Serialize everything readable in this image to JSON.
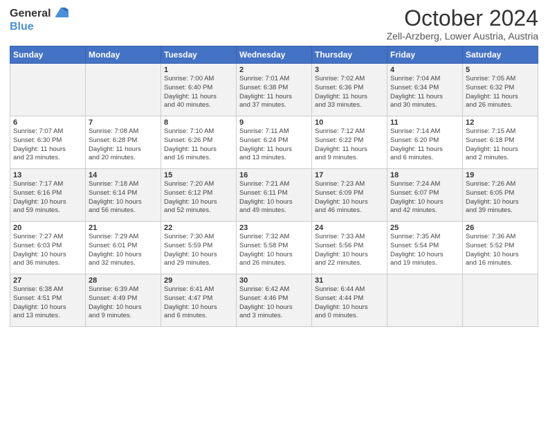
{
  "header": {
    "logo_line1": "General",
    "logo_line2": "Blue",
    "title": "October 2024",
    "location": "Zell-Arzberg, Lower Austria, Austria"
  },
  "days_of_week": [
    "Sunday",
    "Monday",
    "Tuesday",
    "Wednesday",
    "Thursday",
    "Friday",
    "Saturday"
  ],
  "weeks": [
    [
      {
        "day": "",
        "info": ""
      },
      {
        "day": "",
        "info": ""
      },
      {
        "day": "1",
        "info": "Sunrise: 7:00 AM\nSunset: 6:40 PM\nDaylight: 11 hours\nand 40 minutes."
      },
      {
        "day": "2",
        "info": "Sunrise: 7:01 AM\nSunset: 6:38 PM\nDaylight: 11 hours\nand 37 minutes."
      },
      {
        "day": "3",
        "info": "Sunrise: 7:02 AM\nSunset: 6:36 PM\nDaylight: 11 hours\nand 33 minutes."
      },
      {
        "day": "4",
        "info": "Sunrise: 7:04 AM\nSunset: 6:34 PM\nDaylight: 11 hours\nand 30 minutes."
      },
      {
        "day": "5",
        "info": "Sunrise: 7:05 AM\nSunset: 6:32 PM\nDaylight: 11 hours\nand 26 minutes."
      }
    ],
    [
      {
        "day": "6",
        "info": "Sunrise: 7:07 AM\nSunset: 6:30 PM\nDaylight: 11 hours\nand 23 minutes."
      },
      {
        "day": "7",
        "info": "Sunrise: 7:08 AM\nSunset: 6:28 PM\nDaylight: 11 hours\nand 20 minutes."
      },
      {
        "day": "8",
        "info": "Sunrise: 7:10 AM\nSunset: 6:26 PM\nDaylight: 11 hours\nand 16 minutes."
      },
      {
        "day": "9",
        "info": "Sunrise: 7:11 AM\nSunset: 6:24 PM\nDaylight: 11 hours\nand 13 minutes."
      },
      {
        "day": "10",
        "info": "Sunrise: 7:12 AM\nSunset: 6:22 PM\nDaylight: 11 hours\nand 9 minutes."
      },
      {
        "day": "11",
        "info": "Sunrise: 7:14 AM\nSunset: 6:20 PM\nDaylight: 11 hours\nand 6 minutes."
      },
      {
        "day": "12",
        "info": "Sunrise: 7:15 AM\nSunset: 6:18 PM\nDaylight: 11 hours\nand 2 minutes."
      }
    ],
    [
      {
        "day": "13",
        "info": "Sunrise: 7:17 AM\nSunset: 6:16 PM\nDaylight: 10 hours\nand 59 minutes."
      },
      {
        "day": "14",
        "info": "Sunrise: 7:18 AM\nSunset: 6:14 PM\nDaylight: 10 hours\nand 56 minutes."
      },
      {
        "day": "15",
        "info": "Sunrise: 7:20 AM\nSunset: 6:12 PM\nDaylight: 10 hours\nand 52 minutes."
      },
      {
        "day": "16",
        "info": "Sunrise: 7:21 AM\nSunset: 6:11 PM\nDaylight: 10 hours\nand 49 minutes."
      },
      {
        "day": "17",
        "info": "Sunrise: 7:23 AM\nSunset: 6:09 PM\nDaylight: 10 hours\nand 46 minutes."
      },
      {
        "day": "18",
        "info": "Sunrise: 7:24 AM\nSunset: 6:07 PM\nDaylight: 10 hours\nand 42 minutes."
      },
      {
        "day": "19",
        "info": "Sunrise: 7:26 AM\nSunset: 6:05 PM\nDaylight: 10 hours\nand 39 minutes."
      }
    ],
    [
      {
        "day": "20",
        "info": "Sunrise: 7:27 AM\nSunset: 6:03 PM\nDaylight: 10 hours\nand 36 minutes."
      },
      {
        "day": "21",
        "info": "Sunrise: 7:29 AM\nSunset: 6:01 PM\nDaylight: 10 hours\nand 32 minutes."
      },
      {
        "day": "22",
        "info": "Sunrise: 7:30 AM\nSunset: 5:59 PM\nDaylight: 10 hours\nand 29 minutes."
      },
      {
        "day": "23",
        "info": "Sunrise: 7:32 AM\nSunset: 5:58 PM\nDaylight: 10 hours\nand 26 minutes."
      },
      {
        "day": "24",
        "info": "Sunrise: 7:33 AM\nSunset: 5:56 PM\nDaylight: 10 hours\nand 22 minutes."
      },
      {
        "day": "25",
        "info": "Sunrise: 7:35 AM\nSunset: 5:54 PM\nDaylight: 10 hours\nand 19 minutes."
      },
      {
        "day": "26",
        "info": "Sunrise: 7:36 AM\nSunset: 5:52 PM\nDaylight: 10 hours\nand 16 minutes."
      }
    ],
    [
      {
        "day": "27",
        "info": "Sunrise: 6:38 AM\nSunset: 4:51 PM\nDaylight: 10 hours\nand 13 minutes."
      },
      {
        "day": "28",
        "info": "Sunrise: 6:39 AM\nSunset: 4:49 PM\nDaylight: 10 hours\nand 9 minutes."
      },
      {
        "day": "29",
        "info": "Sunrise: 6:41 AM\nSunset: 4:47 PM\nDaylight: 10 hours\nand 6 minutes."
      },
      {
        "day": "30",
        "info": "Sunrise: 6:42 AM\nSunset: 4:46 PM\nDaylight: 10 hours\nand 3 minutes."
      },
      {
        "day": "31",
        "info": "Sunrise: 6:44 AM\nSunset: 4:44 PM\nDaylight: 10 hours\nand 0 minutes."
      },
      {
        "day": "",
        "info": ""
      },
      {
        "day": "",
        "info": ""
      }
    ]
  ]
}
